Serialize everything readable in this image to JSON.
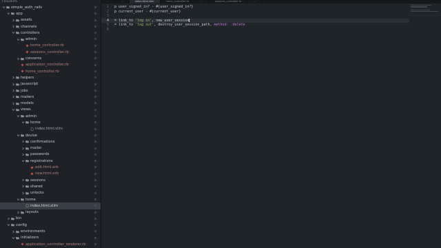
{
  "sidebar": {
    "header": "FOLDERS",
    "items": [
      {
        "label": "simple_auth_rails",
        "depth": 0,
        "kind": "folder",
        "open": true
      },
      {
        "label": "app",
        "depth": 1,
        "kind": "folder",
        "open": true
      },
      {
        "label": "assets",
        "depth": 2,
        "kind": "folder",
        "open": false
      },
      {
        "label": "channels",
        "depth": 2,
        "kind": "folder",
        "open": false
      },
      {
        "label": "controllers",
        "depth": 2,
        "kind": "folder",
        "open": true
      },
      {
        "label": "admin",
        "depth": 3,
        "kind": "folder",
        "open": true
      },
      {
        "label": "home_controller.rb",
        "depth": 4,
        "kind": "ruby"
      },
      {
        "label": "sessions_controller.rb",
        "depth": 4,
        "kind": "ruby"
      },
      {
        "label": "concerns",
        "depth": 3,
        "kind": "folder",
        "open": false
      },
      {
        "label": "application_controller.rb",
        "depth": 3,
        "kind": "ruby"
      },
      {
        "label": "home_controller.rb",
        "depth": 3,
        "kind": "ruby"
      },
      {
        "label": "helpers",
        "depth": 2,
        "kind": "folder",
        "open": false
      },
      {
        "label": "javascript",
        "depth": 2,
        "kind": "folder",
        "open": false
      },
      {
        "label": "jobs",
        "depth": 2,
        "kind": "folder",
        "open": false
      },
      {
        "label": "mailers",
        "depth": 2,
        "kind": "folder",
        "open": false
      },
      {
        "label": "models",
        "depth": 2,
        "kind": "folder",
        "open": false
      },
      {
        "label": "views",
        "depth": 2,
        "kind": "folder",
        "open": true
      },
      {
        "label": "admin",
        "depth": 3,
        "kind": "folder",
        "open": true
      },
      {
        "label": "home",
        "depth": 4,
        "kind": "folder",
        "open": true
      },
      {
        "label": "index.html.slim",
        "depth": 5,
        "kind": "file"
      },
      {
        "label": "devise",
        "depth": 3,
        "kind": "folder",
        "open": true
      },
      {
        "label": "confirmations",
        "depth": 4,
        "kind": "folder",
        "open": false
      },
      {
        "label": "mailer",
        "depth": 4,
        "kind": "folder",
        "open": false
      },
      {
        "label": "passwords",
        "depth": 4,
        "kind": "folder",
        "open": false
      },
      {
        "label": "registrations",
        "depth": 4,
        "kind": "folder",
        "open": true
      },
      {
        "label": "edit.html.erb",
        "depth": 5,
        "kind": "ruby"
      },
      {
        "label": "new.html.erb",
        "depth": 5,
        "kind": "ruby"
      },
      {
        "label": "sessions",
        "depth": 4,
        "kind": "folder",
        "open": false
      },
      {
        "label": "shared",
        "depth": 4,
        "kind": "folder",
        "open": false
      },
      {
        "label": "unlocks",
        "depth": 4,
        "kind": "folder",
        "open": false
      },
      {
        "label": "home",
        "depth": 3,
        "kind": "folder",
        "open": true
      },
      {
        "label": "index.html.slim",
        "depth": 4,
        "kind": "file",
        "selected": true
      },
      {
        "label": "layouts",
        "depth": 3,
        "kind": "folder",
        "open": false
      },
      {
        "label": "bin",
        "depth": 1,
        "kind": "folder",
        "open": false
      },
      {
        "label": "config",
        "depth": 1,
        "kind": "folder",
        "open": true
      },
      {
        "label": "environments",
        "depth": 2,
        "kind": "folder",
        "open": false
      },
      {
        "label": "initializers",
        "depth": 2,
        "kind": "folder",
        "open": true
      },
      {
        "label": "application_controller_renderer.rb",
        "depth": 3,
        "kind": "ruby"
      }
    ]
  },
  "tabs": [
    {
      "label": "...",
      "active": false
    },
    {
      "label": "...",
      "active": false
    },
    {
      "label": "index.html.slim",
      "active": true
    },
    {
      "label": "home_controller.rb",
      "active": false
    },
    {
      "label": "...",
      "active": false
    },
    {
      "label": "sessions_controller.rb",
      "active": false
    },
    {
      "label": "...",
      "active": false
    }
  ],
  "editor": {
    "current_line": 4,
    "lines": [
      [
        {
          "t": "p user_signed_in? - #{user_signed_in?}",
          "c": ""
        }
      ],
      [
        {
          "t": "p current_user - #{current_user}",
          "c": ""
        }
      ],
      [
        {
          "t": "",
          "c": ""
        }
      ],
      [
        {
          "t": "= link_to ",
          "c": ""
        },
        {
          "t": "'log in'",
          "c": "tok-str"
        },
        {
          "t": ", new_user_session",
          "c": ""
        }
      ],
      [
        {
          "t": "= link_to ",
          "c": ""
        },
        {
          "t": "'log out'",
          "c": "tok-str"
        },
        {
          "t": ", destroy_user_session_path, ",
          "c": ""
        },
        {
          "t": "method: :delete",
          "c": "tok-sym"
        }
      ],
      [
        {
          "t": "",
          "c": ""
        }
      ]
    ],
    "line_numbers": [
      "1",
      "2",
      "3",
      "4",
      "5",
      "6"
    ]
  },
  "colors": {
    "ruby_icon": "#c0504d",
    "folder_icon": "#8b929a",
    "string": "#9fbf6b",
    "symbol": "#c678dd"
  }
}
